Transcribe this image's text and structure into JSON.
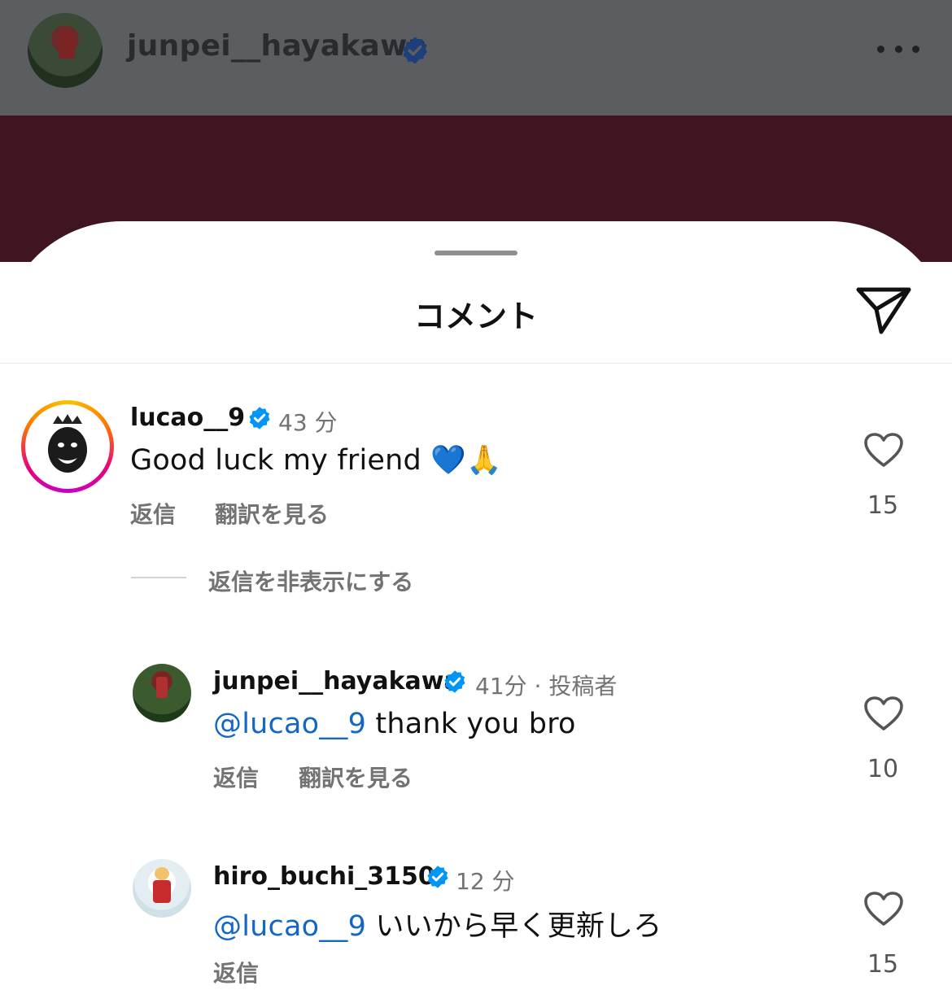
{
  "header": {
    "username": "junpei__hayakawa",
    "verified_icon": "verified-badge-icon",
    "more_icon": "more-horizontal-icon"
  },
  "sheet": {
    "title": "コメント",
    "share_icon": "paper-plane-icon"
  },
  "comments": [
    {
      "username": "lucao__9",
      "time": "43 分",
      "text": "Good luck my friend 💙🙏",
      "reply_label": "返信",
      "translate_label": "翻訳を見る",
      "likes": "15"
    }
  ],
  "hide_replies_label": "返信を非表示にする",
  "replies": [
    {
      "username": "junpei__hayakawa",
      "time": "41分 · 投稿者",
      "mention": "@lucao__9",
      "text": " thank you bro",
      "reply_label": "返信",
      "translate_label": "翻訳を見る",
      "likes": "10"
    },
    {
      "username": "hiro_buchi_3150",
      "time": "12 分",
      "mention": "@lucao__9",
      "text": " いいから早く更新しろ",
      "reply_label": "返信",
      "likes": "15"
    }
  ],
  "colors": {
    "verified": "#0095f6",
    "mention": "#1468c4",
    "header_dim": "#5c5d60",
    "maroon": "#3e1520"
  }
}
